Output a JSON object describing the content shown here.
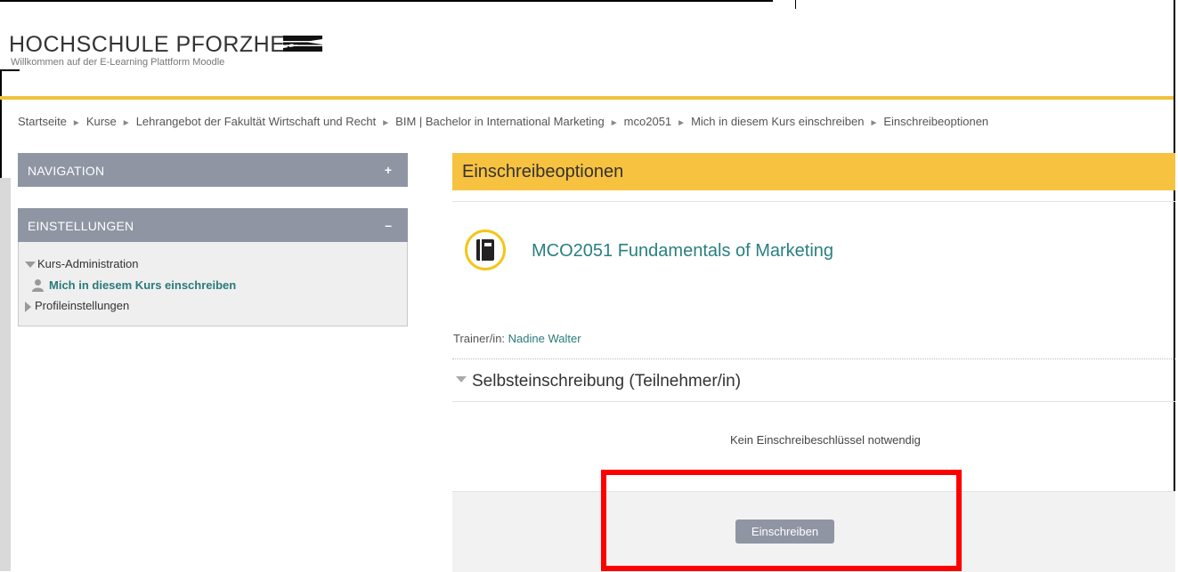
{
  "header": {
    "logo_title": "HOCHSCHULE PFORZHEIM",
    "logo_subtitle": "Willkommen auf der E-Learning Plattform Moodle"
  },
  "breadcrumb": {
    "items": [
      "Startseite",
      "Kurse",
      "Lehrangebot der Fakultät Wirtschaft und Recht",
      "BIM | Bachelor in International Marketing",
      "mco2051",
      "Mich in diesem Kurs einschreiben",
      "Einschreibeoptionen"
    ],
    "separator": "►"
  },
  "sidebar": {
    "navigation": {
      "title": "NAVIGATION",
      "toggle": "+"
    },
    "settings": {
      "title": "EINSTELLUNGEN",
      "toggle": "–",
      "items": [
        {
          "label": "Kurs-Administration"
        },
        {
          "label": "Mich in diesem Kurs einschreiben"
        },
        {
          "label": "Profileinstellungen"
        }
      ]
    }
  },
  "main": {
    "heading": "Einschreibeoptionen",
    "course": {
      "title": "MCO2051 Fundamentals of Marketing",
      "trainer_label": "Trainer/in:",
      "trainer_name": "Nadine Walter",
      "icon": "book-icon"
    },
    "enrolment": {
      "section_title": "Selbsteinschreibung (Teilnehmer/in)",
      "no_key_text": "Kein Einschreibeschlüssel notwendig",
      "button_label": "Einschreiben"
    }
  },
  "colors": {
    "accent_gold": "#f7c240",
    "block_header": "#8f95a3",
    "link": "#2a7a7a",
    "highlight": "#ff0000"
  }
}
